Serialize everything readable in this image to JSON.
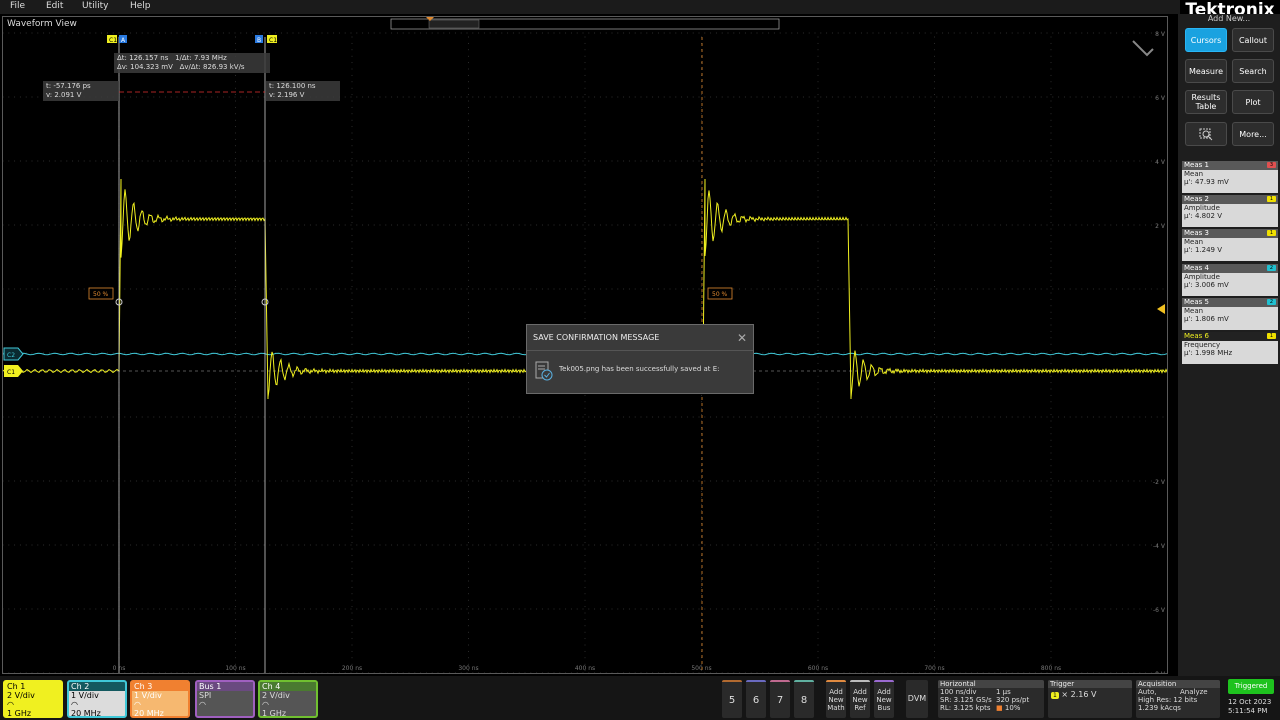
{
  "menu": {
    "items": [
      "File",
      "Edit",
      "Utility",
      "Help"
    ]
  },
  "brand": "Tektronix",
  "sidebar": {
    "subtitle": "Add New...",
    "buttons": [
      {
        "label": "Cursors",
        "active": true
      },
      {
        "label": "Callout",
        "active": false
      },
      {
        "label": "Measure",
        "active": false
      },
      {
        "label": "Search",
        "active": false
      },
      {
        "label": "Results Table",
        "active": false
      },
      {
        "label": "Plot",
        "active": false
      },
      {
        "label": "",
        "icon": "zoom-icon",
        "active": false
      },
      {
        "label": "More...",
        "active": false
      }
    ],
    "measurements": [
      {
        "name": "Meas 1",
        "type": "Mean",
        "value": "μ': 47.93 mV",
        "badge": "3",
        "badge_color": "#e05050"
      },
      {
        "name": "Meas 2",
        "type": "Amplitude",
        "value": "μ': 4.802 V",
        "badge": "1",
        "badge_color": "#f0e000"
      },
      {
        "name": "Meas 3",
        "type": "Mean",
        "value": "μ': 1.249 V",
        "badge": "1",
        "badge_color": "#f0e000"
      },
      {
        "name": "Meas 4",
        "type": "Amplitude",
        "value": "μ': 3.006 mV",
        "badge": "2",
        "badge_color": "#20c0d0"
      },
      {
        "name": "Meas 5",
        "type": "Mean",
        "value": "μ': 1.806 mV",
        "badge": "2",
        "badge_color": "#20c0d0"
      },
      {
        "name": "Meas 6",
        "type": "Frequency",
        "value": "μ': 1.998 MHz",
        "badge": "1",
        "badge_color": "#f0e000",
        "selected": true
      }
    ]
  },
  "waveform": {
    "title": "Waveform View",
    "y_labels": [
      "8 V",
      "6 V",
      "4 V",
      "2 V",
      "-2 V",
      "-4 V",
      "-6 V",
      "-8 V"
    ],
    "x_labels": [
      "0 ns",
      "100 ns",
      "200 ns",
      "300 ns",
      "400 ns",
      "500 ns",
      "600 ns",
      "700 ns",
      "800 ns"
    ],
    "ch1_color": "#f0f020",
    "ch2_color": "#40c8d8",
    "cursor_a_label": "A",
    "cursor_b_label": "B",
    "cursor_source": "C1",
    "delta_readout": {
      "dt": "Δt: 126.157 ns",
      "inv": "1/Δt: 7.93 MHz",
      "dv": "Δv: 104.323 mV",
      "dvdt": "Δv/Δt: 826.93 kV/s"
    },
    "cursor_a_readout": {
      "t": "t: -57.176 ps",
      "v": "v: 2.091 V"
    },
    "cursor_b_readout": {
      "t": "t: 126.100 ns",
      "v": "v: 2.196 V"
    },
    "ref_level": "50 %",
    "ch_markers": [
      "C2",
      "C1"
    ]
  },
  "dialog": {
    "title": "SAVE CONFIRMATION MESSAGE",
    "message": "Tek005.png has been successfully saved at E:"
  },
  "channels": [
    {
      "name": "Ch 1",
      "lines": [
        "2 V/div",
        "",
        "1 GHz"
      ],
      "color": "#f0f020",
      "bg": "#f0f020",
      "text": "#000"
    },
    {
      "name": "Ch 2",
      "lines": [
        "1 V/div",
        "",
        "20 MHz"
      ],
      "color": "#40c8d8",
      "bg": "#dcdcdc",
      "text": "#000"
    },
    {
      "name": "Ch 3",
      "lines": [
        "1 V/div",
        "",
        "20 MHz"
      ],
      "color": "#f08030",
      "bg": "#f6b870",
      "text": "#fff"
    },
    {
      "name": "Bus 1",
      "lines": [
        "SPI",
        "",
        ""
      ],
      "color": "#a060c0",
      "bg": "#555",
      "text": "#ddd"
    },
    {
      "name": "Ch 4",
      "lines": [
        "2 V/div",
        "",
        "1 GHz"
      ],
      "color": "#70c030",
      "bg": "#555",
      "text": "#ddd"
    }
  ],
  "num_buttons": [
    "5",
    "6",
    "7",
    "8"
  ],
  "add_buttons": [
    "Add New Math",
    "Add New Ref",
    "Add New Bus"
  ],
  "dvm": "DVM",
  "horizontal": {
    "title": "Horizontal",
    "l1": "100 ns/div",
    "l1b": "1 μs",
    "l2": "SR: 3.125 GS/s",
    "l2b": "320 ps/pt",
    "l3": "RL: 3.125 kpts",
    "l3b": "10%"
  },
  "trigger": {
    "title": "Trigger",
    "level": "2.16 V",
    "source": "1"
  },
  "acquisition": {
    "title": "Acquisition",
    "l1": "Auto,",
    "l1b": "Analyze",
    "l2": "High Res: 12 bits",
    "l3": "1.239 kAcqs"
  },
  "status": {
    "state": "Triggered",
    "date": "12 Oct 2023",
    "time": "5:11:54 PM"
  }
}
